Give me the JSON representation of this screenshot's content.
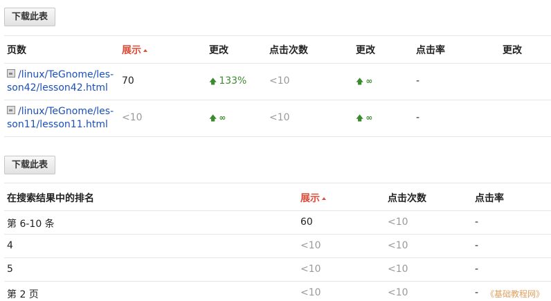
{
  "download_label": "下载此表",
  "table1": {
    "headers": [
      "页数",
      "展示",
      "更改",
      "点击次数",
      "更改",
      "点击率",
      "更改"
    ],
    "rows": [
      {
        "url_line1": "/linux/TeGnome/les-",
        "url_line2": "son42/lesson42.html",
        "impressions": "70",
        "change": "133%",
        "clicks": "<10",
        "change2": "∞",
        "ctr": "-"
      },
      {
        "url_line1": "/linux/TeGnome/les-",
        "url_line2": "son11/lesson11.html",
        "impressions": "<10",
        "change": "∞",
        "clicks": "<10",
        "change2": "∞",
        "ctr": "-"
      }
    ]
  },
  "table2": {
    "headers": [
      "在搜索结果中的排名",
      "展示",
      "点击次数",
      "点击率"
    ],
    "rows": [
      {
        "rank": "第 6-10 条",
        "impressions": "60",
        "clicks": "<10",
        "ctr": "-"
      },
      {
        "rank": "4",
        "impressions": "<10",
        "clicks": "<10",
        "ctr": "-"
      },
      {
        "rank": "5",
        "impressions": "<10",
        "clicks": "<10",
        "ctr": "-"
      },
      {
        "rank": "第 2 页",
        "impressions": "<10",
        "clicks": "<10",
        "ctr": "-"
      }
    ]
  },
  "watermark": "《基础教程网》",
  "icons": {
    "up_arrow": "up-arrow-icon",
    "page": "page-icon",
    "sort": "sort-asc-icon"
  },
  "colors": {
    "sorted_header": "#dd4b39",
    "increase": "#3c8a2e",
    "link": "#1a4fb8",
    "muted": "#999999"
  }
}
